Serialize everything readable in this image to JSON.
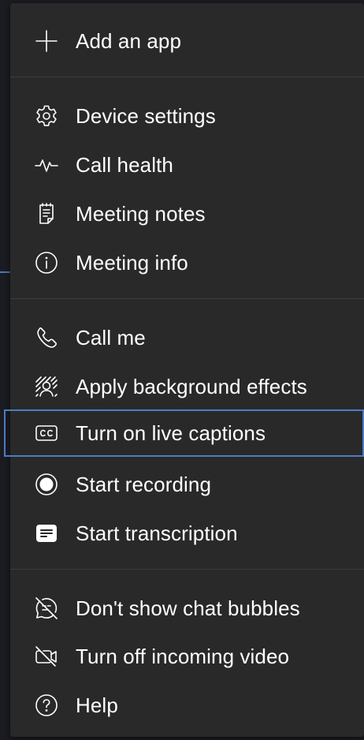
{
  "menu": {
    "items": [
      {
        "id": "add-an-app",
        "label": "Add an app",
        "icon": "plus-icon"
      },
      {
        "id": "device-settings",
        "label": "Device settings",
        "icon": "gear-icon"
      },
      {
        "id": "call-health",
        "label": "Call health",
        "icon": "pulse-icon"
      },
      {
        "id": "meeting-notes",
        "label": "Meeting notes",
        "icon": "notes-icon"
      },
      {
        "id": "meeting-info",
        "label": "Meeting info",
        "icon": "info-icon"
      },
      {
        "id": "call-me",
        "label": "Call me",
        "icon": "phone-icon"
      },
      {
        "id": "apply-background-effects",
        "label": "Apply background effects",
        "icon": "background-effects-icon"
      },
      {
        "id": "turn-on-live-captions",
        "label": "Turn on live captions",
        "icon": "closed-captions-icon",
        "focused": true
      },
      {
        "id": "start-recording",
        "label": "Start recording",
        "icon": "record-icon"
      },
      {
        "id": "start-transcription",
        "label": "Start transcription",
        "icon": "transcript-icon"
      },
      {
        "id": "dont-show-chat-bubbles",
        "label": "Don't show chat bubbles",
        "icon": "chat-bubble-off-icon"
      },
      {
        "id": "turn-off-incoming-video",
        "label": "Turn off incoming video",
        "icon": "video-off-icon"
      },
      {
        "id": "help",
        "label": "Help",
        "icon": "help-icon"
      }
    ]
  },
  "colors": {
    "menu_background": "#292929",
    "focus_ring": "#4b7bc4",
    "text": "#ffffff",
    "divider": "#3d3d3d"
  }
}
